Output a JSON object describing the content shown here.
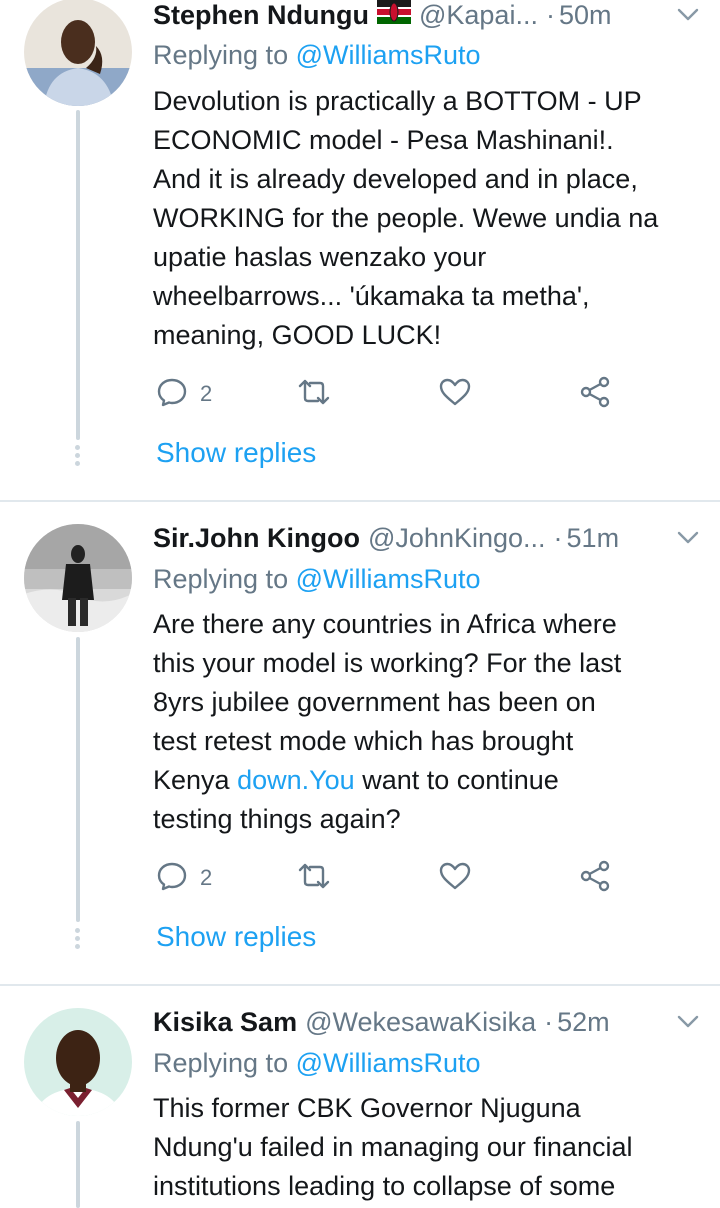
{
  "tweets": [
    {
      "name": "Stephen Ndungu",
      "handle": "@Kapai...",
      "time": "50m",
      "replying_prefix": "Replying to",
      "replying_to": "@WilliamsRuto",
      "lines": [
        "Devolution is practically a BOTTOM - UP",
        "ECONOMIC model - Pesa Mashinani!.",
        "And it is already developed and in place,",
        "WORKING for the people. Wewe undia na",
        "upatie haslas wenzako your",
        "wheelbarrows... 'úkamaka ta metha',",
        "meaning, GOOD LUCK!"
      ],
      "reply_count": "2",
      "show_replies": "Show replies",
      "has_flag": true
    },
    {
      "name": "Sir.John Kingoo",
      "handle": "@JohnKingo...",
      "time": "51m",
      "replying_prefix": "Replying to",
      "replying_to": "@WilliamsRuto",
      "lines": [
        "Are there any countries in Africa where",
        "this your model is working? For the last",
        "8yrs jubilee government has been on",
        "test retest mode which has brought"
      ],
      "line5_pre": "Kenya ",
      "line5_link": "down.You",
      "line5_post": " want to continue",
      "line6": "testing things again?",
      "reply_count": "2",
      "show_replies": "Show replies"
    },
    {
      "name": "Kisika Sam",
      "handle": "@WekesawaKisika",
      "time": "52m",
      "replying_prefix": "Replying to",
      "replying_to": "@WilliamsRuto",
      "lines": [
        "This former CBK Governor Njuguna",
        "Ndung'u failed in managing our financial",
        "institutions leading to collapse of some"
      ]
    }
  ],
  "icons": {
    "reply": "reply-icon",
    "retweet": "retweet-icon",
    "like": "heart-icon",
    "share": "share-icon",
    "caret": "chevron-down-icon"
  },
  "colors": {
    "link": "#1da1f2",
    "secondary_text": "#657786",
    "divider": "#e1e8ed",
    "thread_line": "#ccd6dd"
  }
}
